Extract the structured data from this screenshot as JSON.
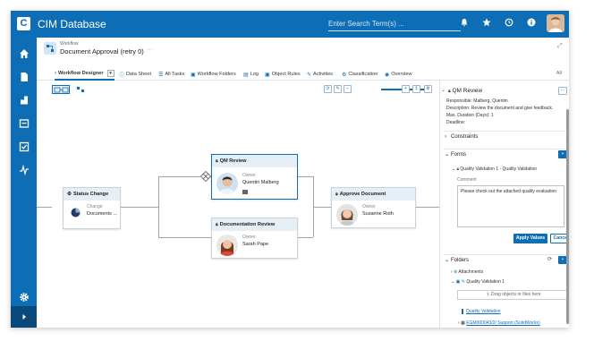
{
  "app": {
    "title": "CIM Database",
    "logo": "C",
    "search_placeholder": "Enter Search Term(s) ...",
    "top_icons": [
      "bell-icon",
      "star-icon",
      "history-icon",
      "info-icon"
    ]
  },
  "nav": {
    "items": [
      "home-icon",
      "document-icon",
      "parts-icon",
      "folder-icon",
      "checkbox-icon",
      "analytics-icon"
    ],
    "bottom": [
      "gear-icon",
      "expand-icon"
    ]
  },
  "object": {
    "type": "Workflow",
    "title": "Document Approval (retry 0)",
    "star": "☆",
    "more": "···",
    "expand": "⤢"
  },
  "tabs": {
    "items": [
      {
        "label": "Workflow Designer",
        "icon": "‹",
        "active": true
      },
      {
        "label": "Data Sheet",
        "icon": "ⓘ"
      },
      {
        "label": "All Tasks",
        "icon": "☰"
      },
      {
        "label": "Workflow Folders",
        "icon": "▣"
      },
      {
        "label": "Log",
        "icon": "▤"
      },
      {
        "label": "Object Rules",
        "icon": "▣"
      },
      {
        "label": "Activities",
        "icon": "✎"
      },
      {
        "label": "Classification",
        "icon": "⚙"
      },
      {
        "label": "Overview",
        "icon": "◉"
      }
    ],
    "dropdown": "▾",
    "all_label": "All"
  },
  "toolbar": {
    "buttons": [
      "⟳",
      "✎",
      "−",
      "+",
      "↥",
      "⚙"
    ],
    "zoom_level": 0.95
  },
  "nodes": {
    "status_change": {
      "title": "Status Change",
      "label": "Change",
      "value": "Documents ..."
    },
    "qm_review": {
      "title": "QM Review",
      "label": "Owner",
      "value": "Quentin Malberg"
    },
    "documentation_review": {
      "title": "Documentation Review",
      "label": "Owner",
      "value": "Sarah Pape"
    },
    "approve_document": {
      "title": "Approve Document",
      "label": "Owner",
      "value": "Susanne Roth"
    }
  },
  "panel": {
    "title": "QM Review",
    "responsible_label": "Responsible:",
    "responsible": "Malberg, Quentin",
    "description_label": "Description:",
    "description": "Review the document and give feedback.",
    "max_duration_label": "Max. Duration (Days):",
    "max_duration": "1",
    "deadline_label": "Deadline:",
    "constraints": "Constraints",
    "forms": "Forms",
    "form_name": "Quality Validation 1 - Quality Validation",
    "comment_label": "Comment",
    "comment": "Please check out the attached quality evaluation",
    "apply": "Apply Values",
    "cancel": "Cancel",
    "folders": "Folders",
    "attachments": "Attachments",
    "quality_folder": "Quality Validation 1",
    "drop_hint": "Drag objects or files here",
    "quality_link": "Quality Validation",
    "support_link": "EGM000043/2/ Support (SolidWorks)"
  }
}
